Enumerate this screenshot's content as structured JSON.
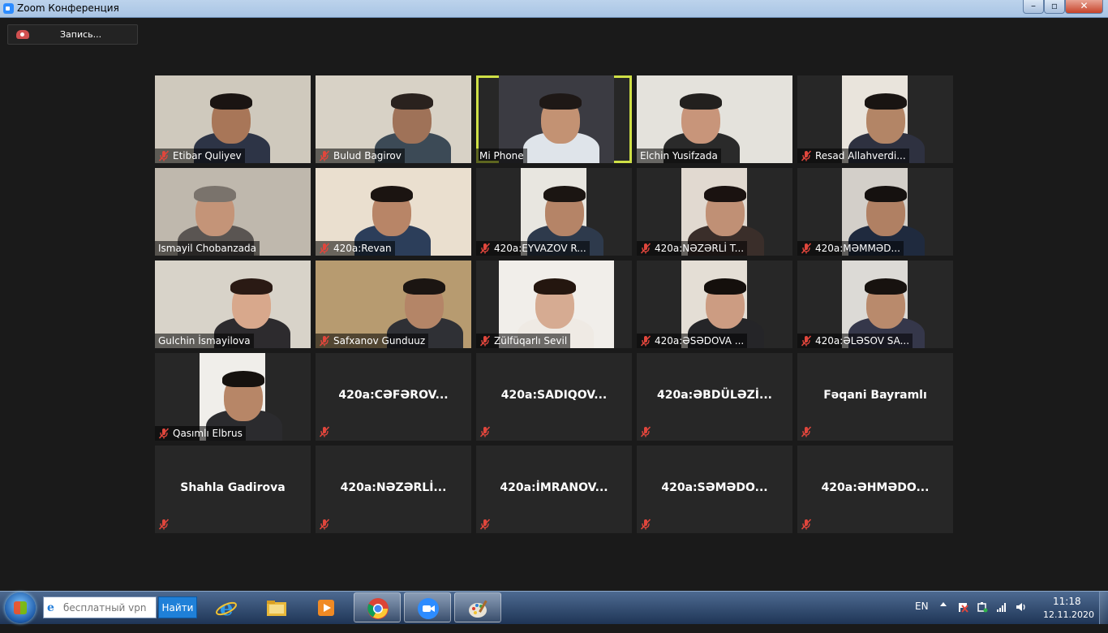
{
  "window": {
    "title": "Zoom Конференция"
  },
  "recording": {
    "label": "Запись..."
  },
  "participants": [
    {
      "name": "Etibar Quliyev",
      "muted": true
    },
    {
      "name": "Bulud Bagirov",
      "muted": true
    },
    {
      "name": "Mi Phone",
      "muted": false,
      "active_speaker": true
    },
    {
      "name": "Elchin Yusifzada",
      "muted": false
    },
    {
      "name": "Resad Allahverdi...",
      "muted": true
    },
    {
      "name": "Ismayil Chobanzada",
      "muted": false
    },
    {
      "name": "420a:Revan",
      "muted": true
    },
    {
      "name": "420a:EYVAZOV R...",
      "muted": true
    },
    {
      "name": "420a:NƏZƏRLİ T...",
      "muted": true
    },
    {
      "name": "420a:MƏMMƏD...",
      "muted": true
    },
    {
      "name": "Gulchin İsmayilova",
      "muted": false
    },
    {
      "name": "Safxanov Gunduuz",
      "muted": true
    },
    {
      "name": "Zülfüqarlı Sevil",
      "muted": true
    },
    {
      "name": "420a:ƏSƏDOVA ...",
      "muted": true
    },
    {
      "name": "420a:ƏLƏSOV SA...",
      "muted": true
    },
    {
      "name": "Qasımlı Elbrus",
      "muted": true
    },
    {
      "name": "420a:CƏFƏROV...",
      "muted": true
    },
    {
      "name": "420a:SADIQOV...",
      "muted": true
    },
    {
      "name": "420a:ƏBDÜLƏZİ...",
      "muted": true
    },
    {
      "name": "Fəqani Bayramlı",
      "muted": true
    },
    {
      "name": "Shahla Gadirova",
      "muted": true
    },
    {
      "name": "420a:NƏZƏRLİ...",
      "muted": true
    },
    {
      "name": "420a:İMRANOV...",
      "muted": true
    },
    {
      "name": "420a:SƏMƏDO...",
      "muted": true
    },
    {
      "name": "420a:ƏHMƏDO...",
      "muted": true
    }
  ],
  "taskbar": {
    "search_placeholder": "бесплатный vpn",
    "search_button": "Найти",
    "apps": [
      "internet-explorer-icon",
      "file-explorer-icon",
      "media-player-icon",
      "chrome-icon",
      "zoom-icon",
      "paint-icon"
    ],
    "language": "EN",
    "clock_time": "11:18",
    "clock_date": "12.11.2020"
  },
  "colors": {
    "background": "#1a1a1a",
    "tile": "#272727",
    "active_speaker_border": "#cfe046",
    "mute_red": "#e0463c"
  }
}
